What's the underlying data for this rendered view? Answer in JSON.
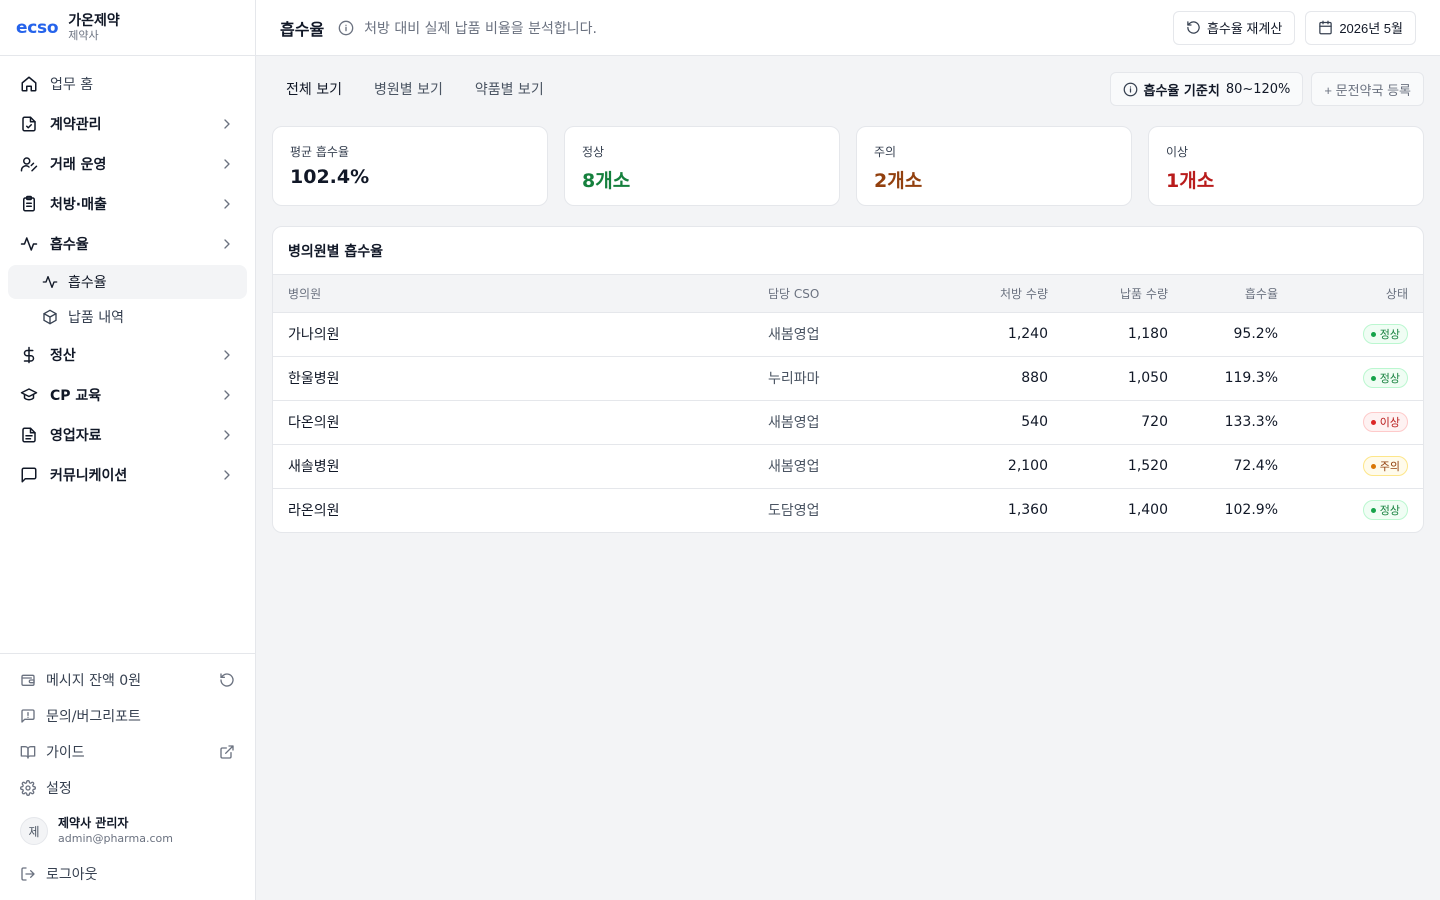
{
  "brand": {
    "logo": "ecso",
    "name": "가온제약",
    "sub": "제약사"
  },
  "nav": {
    "home": "업무 홈",
    "items": [
      {
        "label": "계약관리"
      },
      {
        "label": "거래 운영"
      },
      {
        "label": "처방·매출"
      },
      {
        "label": "흡수율"
      }
    ],
    "sub_items": [
      {
        "label": "흡수율"
      },
      {
        "label": "납품 내역"
      }
    ],
    "items_after": [
      {
        "label": "정산"
      },
      {
        "label": "CP 교육"
      },
      {
        "label": "영업자료"
      },
      {
        "label": "커뮤니케이션"
      }
    ]
  },
  "bottom": {
    "balance": "메시지 잔액 0원",
    "report": "문의/버그리포트",
    "guide": "가이드",
    "settings": "설정",
    "user_initial": "제",
    "user_name": "제약사 관리자",
    "user_email": "admin@pharma.com",
    "logout": "로그아웃"
  },
  "header": {
    "title": "흡수율",
    "description": "처방 대비 실제 납품 비율을 분석합니다.",
    "recalc_label": "흡수율 재계산",
    "month_label": "2026년 5월"
  },
  "tabs": [
    "전체 보기",
    "병원별 보기",
    "약품별 보기"
  ],
  "criteria": {
    "label": "흡수율 기준치",
    "value": "80~120%"
  },
  "register_label": "+ 문전약국 등록",
  "summary": [
    {
      "label": "평균 흡수율",
      "value": "102.4%",
      "tone": ""
    },
    {
      "label": "정상",
      "value": "8개소",
      "tone": "green"
    },
    {
      "label": "주의",
      "value": "2개소",
      "tone": "orange"
    },
    {
      "label": "이상",
      "value": "1개소",
      "tone": "red"
    }
  ],
  "table": {
    "title": "병의원별 흡수율",
    "columns": [
      "병의원",
      "담당 CSO",
      "처방 수량",
      "납품 수량",
      "흡수율",
      "상태"
    ],
    "rows": [
      {
        "clinic": "가나의원",
        "cso": "새봄영업",
        "rx": "1,240",
        "delivered": "1,180",
        "rate": "95.2%",
        "status": "정상",
        "tone": "normal"
      },
      {
        "clinic": "한울병원",
        "cso": "누리파마",
        "rx": "880",
        "delivered": "1,050",
        "rate": "119.3%",
        "status": "정상",
        "tone": "normal"
      },
      {
        "clinic": "다온의원",
        "cso": "새봄영업",
        "rx": "540",
        "delivered": "720",
        "rate": "133.3%",
        "status": "이상",
        "tone": "abnormal"
      },
      {
        "clinic": "새솔병원",
        "cso": "새봄영업",
        "rx": "2,100",
        "delivered": "1,520",
        "rate": "72.4%",
        "status": "주의",
        "tone": "caution"
      },
      {
        "clinic": "라온의원",
        "cso": "도담영업",
        "rx": "1,360",
        "delivered": "1,400",
        "rate": "102.9%",
        "status": "정상",
        "tone": "normal"
      }
    ]
  }
}
